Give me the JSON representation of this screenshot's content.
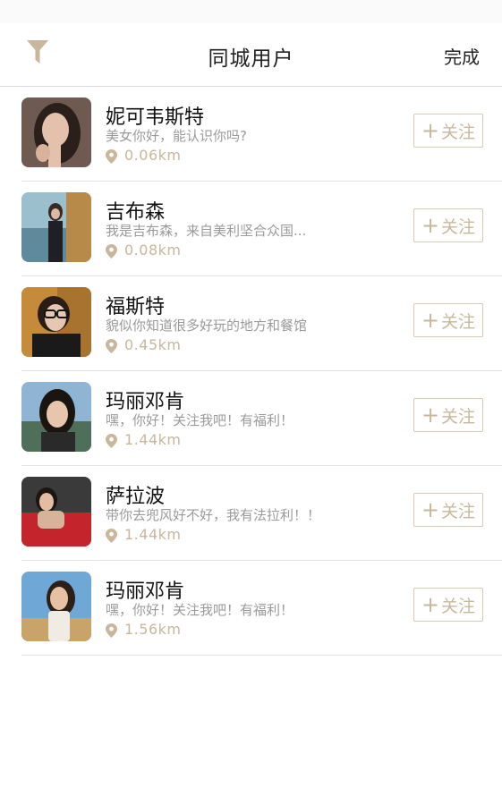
{
  "header": {
    "title": "同城用户",
    "done_label": "完成",
    "filter_icon": "filter-icon"
  },
  "colors": {
    "accent": "#c9b79c",
    "button_border": "#d8c9b2",
    "text_primary": "#111111",
    "text_secondary": "#9a9a9a",
    "divider": "#e3e3e3"
  },
  "users": [
    {
      "name": "妮可韦斯特",
      "message": "美女你好，能认识你吗?",
      "distance": "0.06km",
      "follow_label": "关注",
      "follow_plus": "+"
    },
    {
      "name": "吉布森",
      "message": "我是吉布森，来自美利坚合众国...",
      "distance": "0.08km",
      "follow_label": "关注",
      "follow_plus": "+"
    },
    {
      "name": "福斯特",
      "message": "貌似你知道很多好玩的地方和餐馆",
      "distance": "0.45km",
      "follow_label": "关注",
      "follow_plus": "+"
    },
    {
      "name": "玛丽邓肯",
      "message": "嘿，你好！关注我吧！有福利！",
      "distance": "1.44km",
      "follow_label": "关注",
      "follow_plus": "+"
    },
    {
      "name": "萨拉波",
      "message": "带你去兜风好不好，我有法拉利！！",
      "distance": "1.44km",
      "follow_label": "关注",
      "follow_plus": "+"
    },
    {
      "name": "玛丽邓肯",
      "message": "嘿，你好！关注我吧！有福利！",
      "distance": "1.56km",
      "follow_label": "关注",
      "follow_plus": "+"
    }
  ]
}
